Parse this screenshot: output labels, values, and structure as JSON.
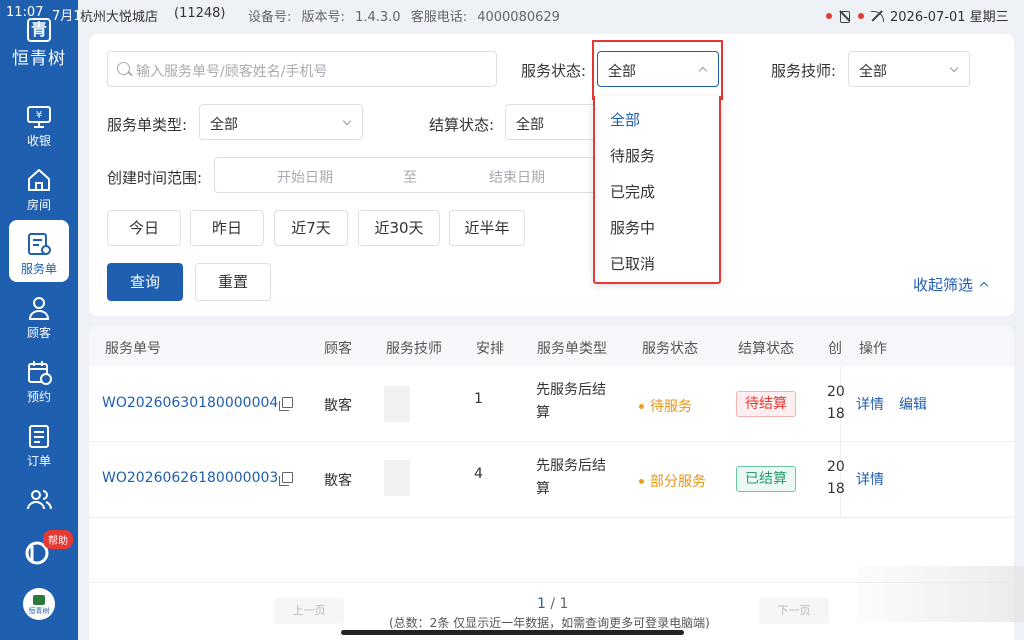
{
  "status_bar": {
    "time": "11:07",
    "date_short": "7月1",
    "store": "杭州大悦城店",
    "store_id": "(11248)",
    "device_label": "设备号:",
    "version_label": "版本号:",
    "version": "1.4.3.0",
    "service_phone_label": "客服电话:",
    "service_phone": "4000080629",
    "datetime": "2026-07-01 星期三"
  },
  "sidebar": {
    "logo_char": "青",
    "brand": "恒青树",
    "items": [
      {
        "label": "收银",
        "icon": "cashier-icon"
      },
      {
        "label": "房间",
        "icon": "home-icon"
      },
      {
        "label": "服务单",
        "icon": "service-order-icon"
      },
      {
        "label": "顾客",
        "icon": "customer-icon"
      },
      {
        "label": "预约",
        "icon": "calendar-icon"
      },
      {
        "label": "订单",
        "icon": "order-icon"
      },
      {
        "label": "",
        "icon": "staff-icon"
      }
    ],
    "help_badge": "帮助",
    "bottom_logo_text": "恒青树"
  },
  "filters": {
    "search_placeholder": "输入服务单号/顾客姓名/手机号",
    "service_status_label": "服务状态:",
    "service_status_value": "全部",
    "technician_label": "服务技师:",
    "technician_value": "全部",
    "order_type_label": "服务单类型:",
    "order_type_value": "全部",
    "settlement_label": "结算状态:",
    "settlement_value": "全部",
    "date_range_label": "创建时间范围:",
    "start_date_placeholder": "开始日期",
    "range_sep": "至",
    "end_date_placeholder": "结束日期",
    "quick_ranges": [
      "今日",
      "昨日",
      "近7天",
      "近30天",
      "近半年"
    ],
    "query_button": "查询",
    "reset_button": "重置",
    "collapse_label": "收起筛选"
  },
  "status_dropdown": {
    "options": [
      "全部",
      "待服务",
      "已完成",
      "服务中",
      "已取消"
    ],
    "selected": "全部"
  },
  "table": {
    "headers": [
      "服务单号",
      "顾客",
      "服务技师",
      "安排",
      "服务单类型",
      "服务状态",
      "结算状态",
      "创",
      "操作"
    ],
    "rows": [
      {
        "order_no": "WO20260630180000004",
        "customer": "散客",
        "arrange": "1",
        "type_line1": "先服务后结",
        "type_line2": "算",
        "status": "待服务",
        "settlement": "待结算",
        "created_1": "20",
        "created_2": "18",
        "actions": [
          "详情",
          "编辑"
        ]
      },
      {
        "order_no": "WO20260626180000003",
        "customer": "散客",
        "arrange": "4",
        "type_line1": "先服务后结",
        "type_line2": "算",
        "status": "部分服务",
        "settlement": "已结算",
        "created_1": "20",
        "created_2": "18",
        "actions": [
          "详情"
        ]
      }
    ]
  },
  "pagination": {
    "prev": "上一页",
    "next": "下一页",
    "current": "1",
    "sep": " / ",
    "total": "1",
    "note": "(总数：2条 仅显示近一年数据，如需查询更多可登录电脑端)"
  },
  "colors": {
    "primary": "#1f5fb0",
    "danger": "#e53935",
    "success": "#2a9d6f",
    "warning": "#e69516"
  }
}
